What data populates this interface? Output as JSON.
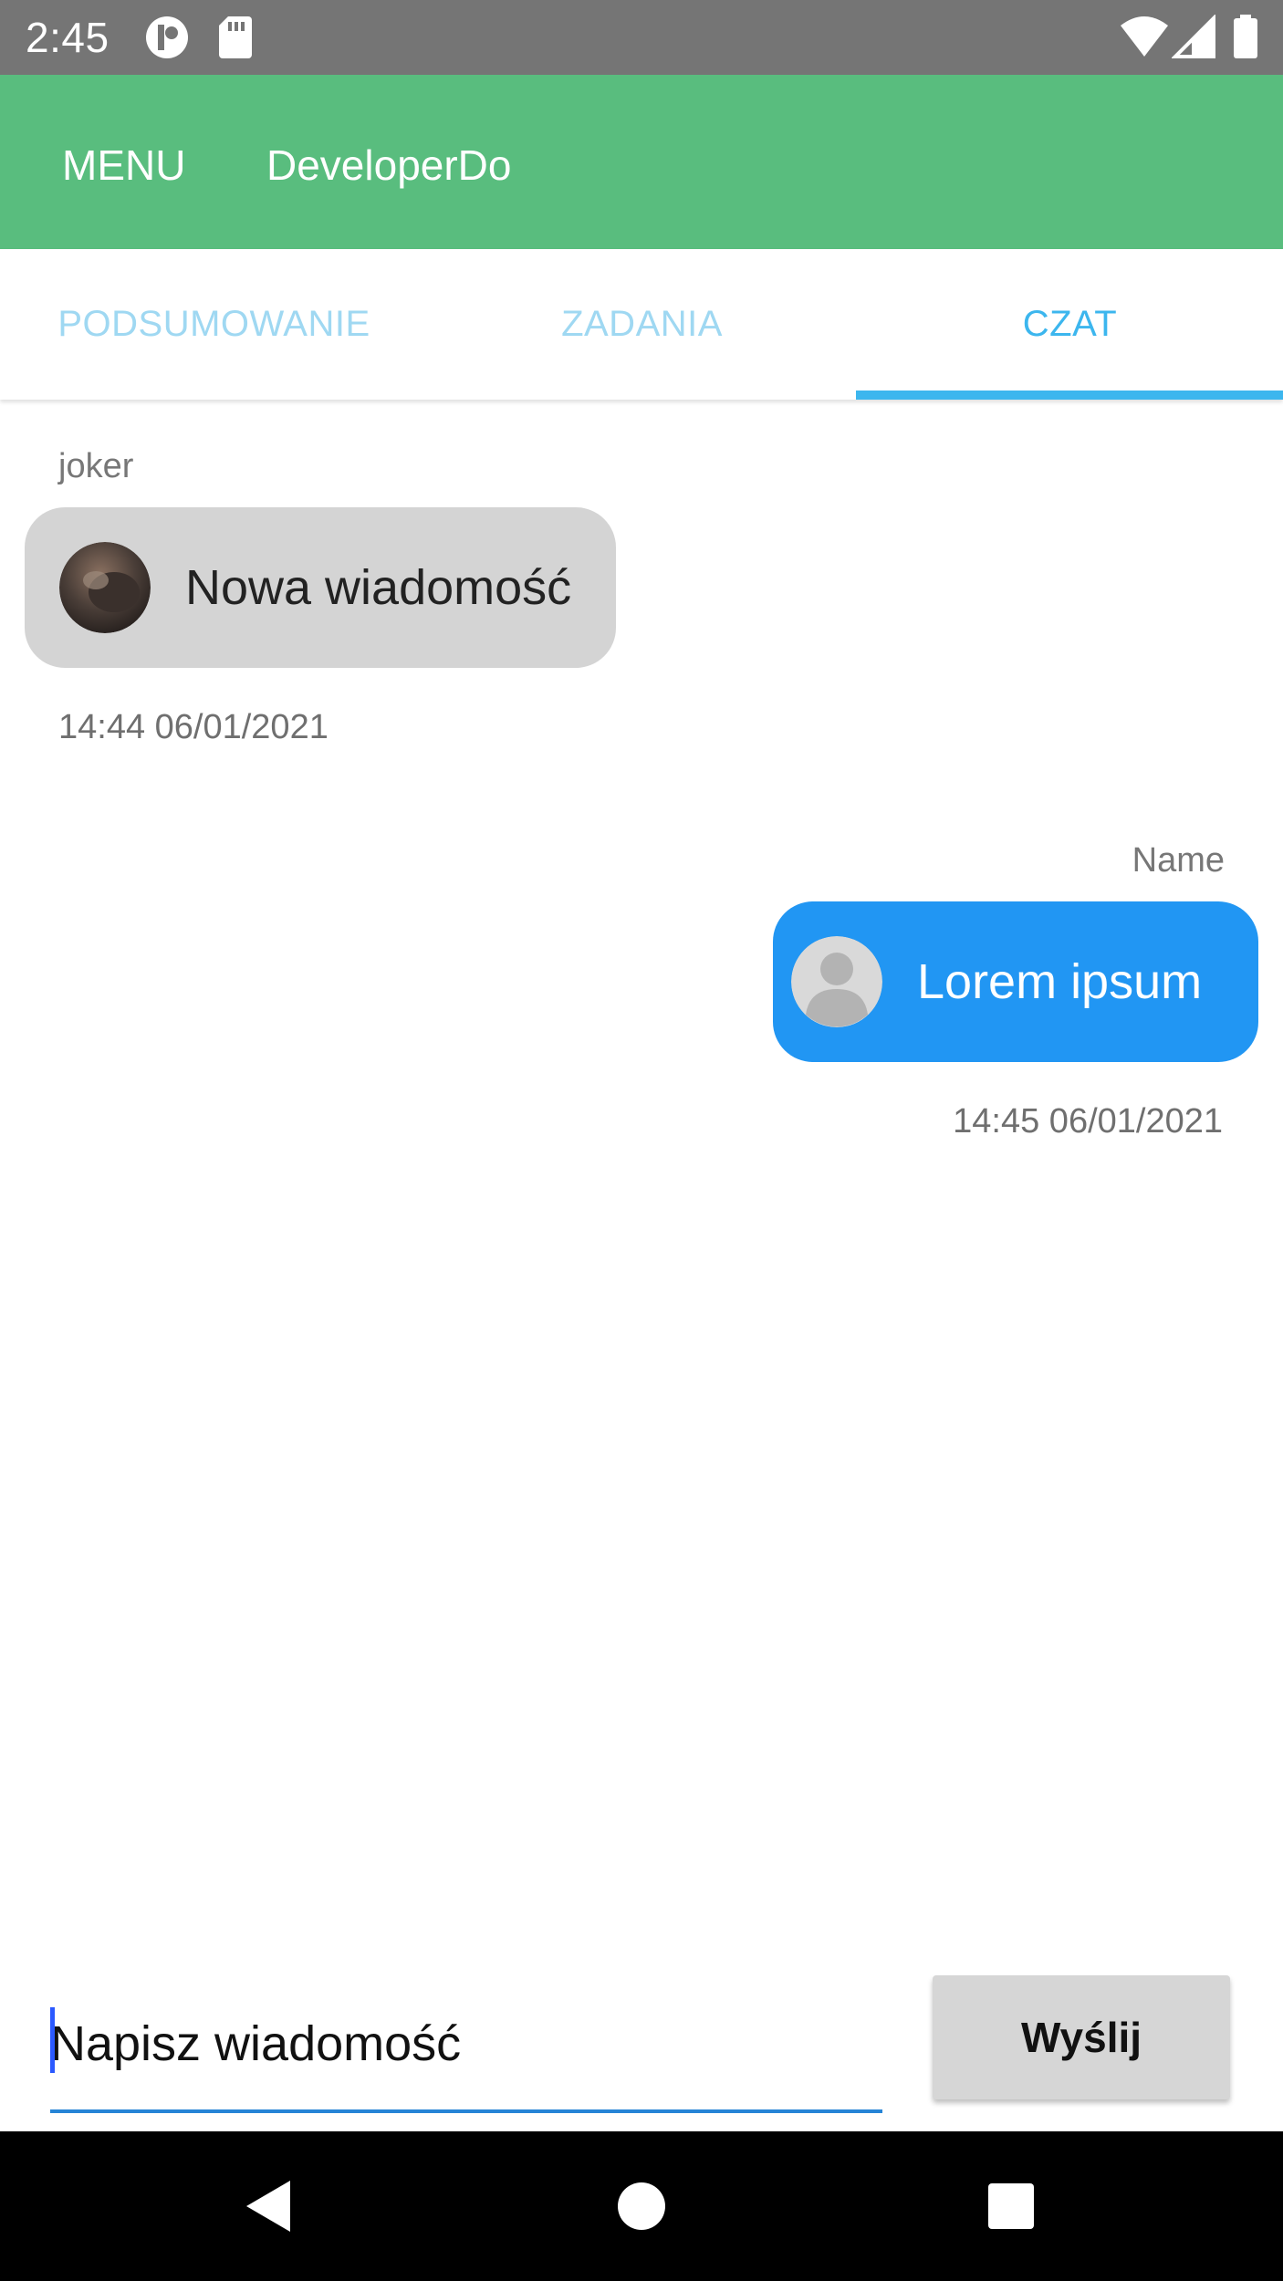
{
  "status_bar": {
    "time": "2:45",
    "icons": [
      "app-indicator-icon",
      "sd-card-icon",
      "wifi-icon",
      "cellular-signal-icon",
      "battery-icon"
    ]
  },
  "app_bar": {
    "menu_label": "MENU",
    "title": "DeveloperDo",
    "color": "#59bd7e"
  },
  "tabs": [
    {
      "label": "PODSUMOWANIE",
      "selected": false
    },
    {
      "label": "ZADANIA",
      "selected": false
    },
    {
      "label": "CZAT",
      "selected": true
    }
  ],
  "chat": {
    "messages": [
      {
        "sender": "joker",
        "text": "Nowa wiadomość",
        "timestamp": "14:44 06/01/2021",
        "direction": "incoming",
        "bubble_color": "#d4d4d4"
      },
      {
        "sender": "Name",
        "text": "Lorem ipsum",
        "timestamp": "14:45 06/01/2021",
        "direction": "outgoing",
        "bubble_color": "#2196f3"
      }
    ]
  },
  "composer": {
    "placeholder": "Napisz wiadomość",
    "value": "",
    "send_label": "Wyślij"
  },
  "nav_bar": {
    "buttons": [
      "back-icon",
      "home-icon",
      "recents-icon"
    ]
  }
}
